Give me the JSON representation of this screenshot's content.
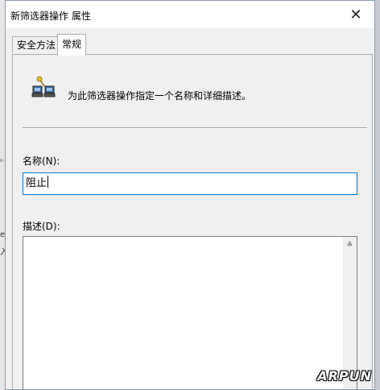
{
  "window": {
    "title": "新筛选器操作 属性",
    "close_glyph": "✕"
  },
  "tabs": [
    {
      "label": "安全方法",
      "active": false
    },
    {
      "label": "常规",
      "active": true
    }
  ],
  "general": {
    "description_text": "为此筛选器操作指定一个名称和详细描述。",
    "name_label": "名称(N):",
    "name_value": "阻止",
    "description_label": "描述(D):",
    "description_value": ""
  },
  "watermark": "ARPUN",
  "background_glyphs": [
    "。",
    "e",
    "入"
  ],
  "icons": {
    "filter_action": "filter-computers-icon",
    "scroll_up": "scroll-up-arrow-icon"
  },
  "colors": {
    "focus_border": "#0078d7",
    "dialog_bg": "#f0f0f0"
  }
}
